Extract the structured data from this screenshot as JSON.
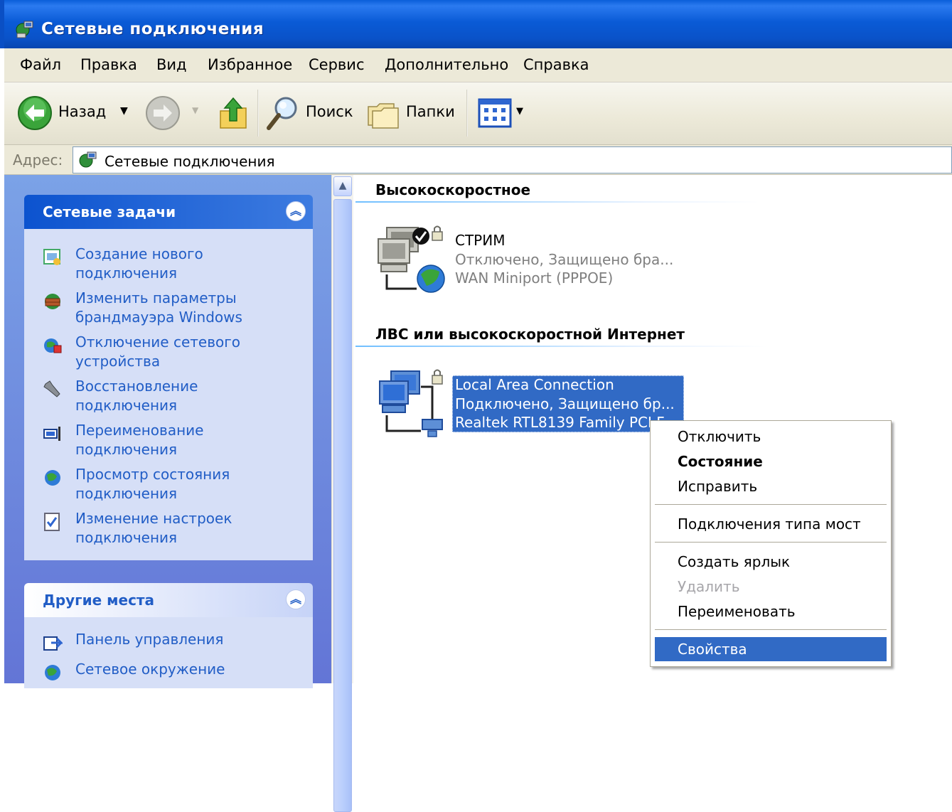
{
  "window": {
    "title": "Сетевые подключения"
  },
  "menu": [
    "Файл",
    "Правка",
    "Вид",
    "Избранное",
    "Сервис",
    "Дополнительно",
    "Справка"
  ],
  "toolbar": {
    "back_label": "Назад",
    "search_label": "Поиск",
    "folders_label": "Папки"
  },
  "address": {
    "label": "Адрес:",
    "value": "Сетевые подключения"
  },
  "left_pane": {
    "network_tasks": {
      "title": "Сетевые задачи",
      "items": [
        "Создание нового подключения",
        "Изменить параметры брандмауэра Windows",
        "Отключение сетевого устройства",
        "Восстановление подключения",
        "Переименование подключения",
        "Просмотр состояния подключения",
        "Изменение настроек подключения"
      ]
    },
    "other_places": {
      "title": "Другие места",
      "items": [
        "Панель управления",
        "Сетевое окружение"
      ]
    }
  },
  "content": {
    "groups": [
      {
        "title": "Высокоскоростное",
        "connection": {
          "name": "СТРИМ",
          "status": "Отключено, Защищено бра...",
          "device": "WAN Miniport (PPPOE)"
        }
      },
      {
        "title": "ЛВС или высокоскоростной Интернет",
        "connection": {
          "name": "Local Area Connection",
          "status": "Подключено, Защищено бр...",
          "device": "Realtek RTL8139 Family PCI F"
        }
      }
    ]
  },
  "context_menu": {
    "items": [
      {
        "label": "Отключить",
        "style": "normal"
      },
      {
        "label": "Состояние",
        "style": "bold"
      },
      {
        "label": "Исправить",
        "style": "normal"
      },
      {
        "label": "Подключения типа мост",
        "style": "normal"
      },
      {
        "label": "Создать ярлык",
        "style": "normal"
      },
      {
        "label": "Удалить",
        "style": "disabled"
      },
      {
        "label": "Переименовать",
        "style": "normal"
      },
      {
        "label": "Свойства",
        "style": "highlighted"
      }
    ]
  },
  "colors": {
    "titlebar": "#0a52c8",
    "task_link": "#215dc6",
    "selection": "#316ac5",
    "pane_gradient_top": "#7ba2e7",
    "pane_gradient_bottom": "#6375d6"
  },
  "icons": {
    "app": "network-connections-icon",
    "back": "back-arrow-icon",
    "forward": "forward-arrow-icon",
    "up": "folder-up-icon",
    "search": "magnifier-icon",
    "folders": "folders-icon",
    "views": "views-icon"
  }
}
